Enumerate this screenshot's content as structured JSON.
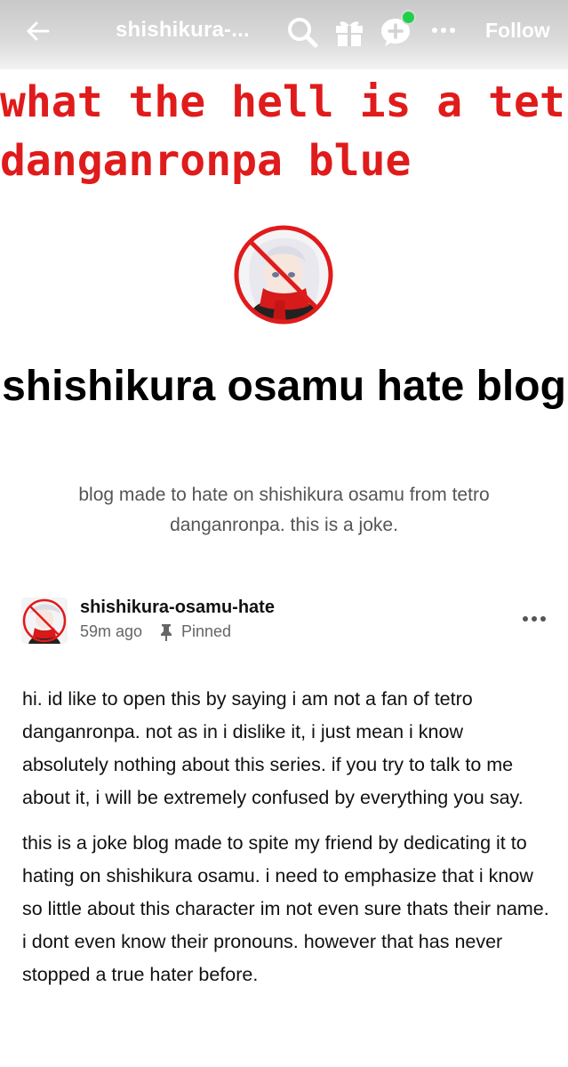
{
  "topbar": {
    "blog_name": "shishikura-...",
    "follow_label": "Follow",
    "icons": [
      "back-arrow-icon",
      "search-icon",
      "gift-icon",
      "chat-icon",
      "more-icon"
    ]
  },
  "header_art": {
    "line1": "what the hell is a tetro",
    "line2": "danganronpa blue"
  },
  "blog": {
    "title": "shishikura osamu hate blog",
    "description": "blog made to hate on shishikura osamu from tetro danganronpa. this is a joke."
  },
  "post": {
    "author": "shishikura-osamu-hate",
    "time": "59m ago",
    "pinned_label": "Pinned",
    "paragraphs": [
      "hi. id like to open this by saying i am not a fan of tetro danganronpa. not as in i dislike it, i just mean i know absolutely nothing about this series. if you try to talk to me about it, i will be extremely confused by everything you say.",
      "this is a joke blog made to spite my friend by dedicating it to hating on shishikura osamu. i need to emphasize that i know so little about this character im not even sure thats their name. i dont even know their pronouns. however that has never stopped a true hater before."
    ]
  },
  "colors": {
    "header_text": "#e01b1b",
    "online_dot": "#1fd14a",
    "topbar_icons": "#ffffff"
  }
}
